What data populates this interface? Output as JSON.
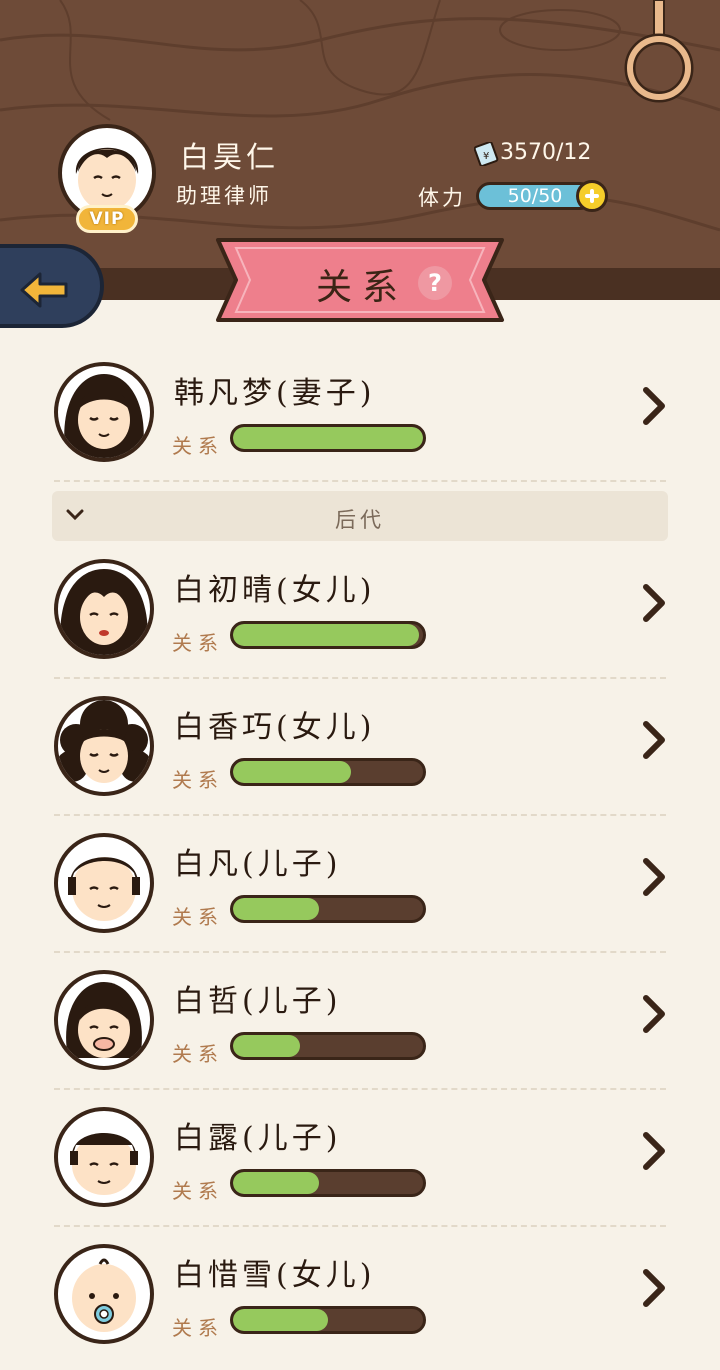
{
  "player": {
    "name": "白昊仁",
    "title": "助理律师",
    "vip_label": "VIP",
    "money": "3570/12",
    "stamina_label": "体力",
    "stamina_value": "50/50"
  },
  "page": {
    "title": "关系",
    "help_symbol": "?"
  },
  "spouse": {
    "name": "韩凡梦(妻子)",
    "relation_label": "关系",
    "relation_level": 1.0
  },
  "section": {
    "title": "后代"
  },
  "children": [
    {
      "name": "白初晴(女儿)",
      "relation_label": "关系",
      "relation_level": 0.98,
      "avatar": "girl-long-hair-avatar"
    },
    {
      "name": "白香巧(女儿)",
      "relation_label": "关系",
      "relation_level": 0.62,
      "avatar": "girl-curly-hair-avatar"
    },
    {
      "name": "白凡(儿子)",
      "relation_label": "关系",
      "relation_level": 0.45,
      "avatar": "boy-avatar"
    },
    {
      "name": "白哲(儿子)",
      "relation_label": "关系",
      "relation_level": 0.35,
      "avatar": "toddler-avatar"
    },
    {
      "name": "白露(儿子)",
      "relation_label": "关系",
      "relation_level": 0.45,
      "avatar": "boy-short-hair-avatar"
    },
    {
      "name": "白惜雪(女儿)",
      "relation_label": "关系",
      "relation_level": 0.5,
      "avatar": "baby-avatar"
    }
  ],
  "colors": {
    "wood": "#6e4b38",
    "ribbon": "#ee7f8c",
    "bar_fill": "#96c95d",
    "bar_empty": "#5a3e2f",
    "back_button": "#2f3f5c",
    "background": "#f7f2e8"
  }
}
